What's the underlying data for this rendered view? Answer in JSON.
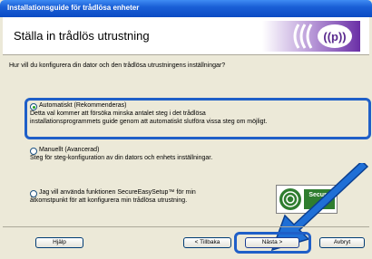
{
  "window": {
    "title": "Installationsguide för trådlösa enheter"
  },
  "header": {
    "heading": "Ställa in trådlös utrustning"
  },
  "question": "Hur vill du konfigurera din dator och den trådlösa utrustningens inställningar?",
  "options": [
    {
      "label": "Automatiskt (Rekommenderas)",
      "desc": [
        "Detta val kommer att försöka minska antalet steg i det trådlösa",
        "installationsprogrammets guide genom att automatiskt slutföra vissa steg om möjligt."
      ],
      "selected": true
    },
    {
      "label": "Manuellt (Avancerad)",
      "desc": [
        "Steg för steg-konfiguration av din dators och enhets inställningar."
      ],
      "selected": false
    },
    {
      "label": "Jag vill använda funktionen SecureEasySetup™ för min",
      "desc": [
        "åtkomstpunkt för att konfigurera min trådlösa utrustning."
      ],
      "selected": false
    }
  ],
  "secure_logo_text": "Secure",
  "buttons": {
    "help": "Hjälp",
    "back": "< Tillbaka",
    "next": "Nästa >",
    "cancel": "Avbryt"
  },
  "colors": {
    "highlight": "#1f5fc8",
    "radio_selected": "#21a121",
    "titlebar": "#1a5fd6",
    "logo_purple": "#7a3fb2"
  }
}
